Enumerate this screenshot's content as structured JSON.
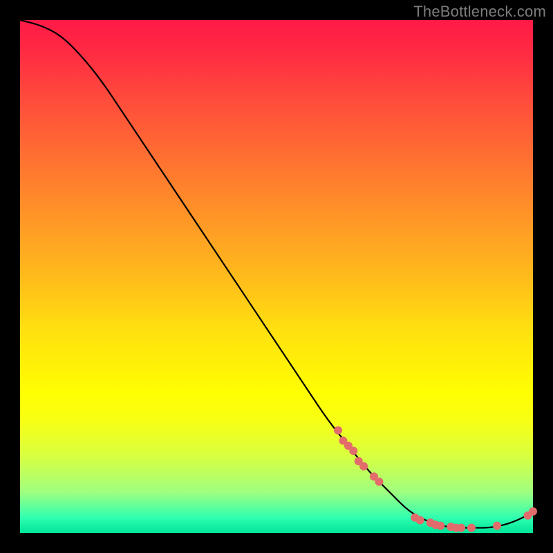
{
  "attribution": "TheBottleneck.com",
  "chart_data": {
    "type": "line",
    "title": "",
    "xlabel": "",
    "ylabel": "",
    "xlim": [
      0,
      100
    ],
    "ylim": [
      0,
      100
    ],
    "grid": false,
    "series": [
      {
        "name": "bottleneck-curve",
        "color": "#000000",
        "x": [
          0,
          4,
          8,
          12,
          16,
          20,
          24,
          28,
          32,
          36,
          40,
          44,
          48,
          52,
          56,
          60,
          64,
          68,
          72,
          76,
          80,
          84,
          88,
          92,
          96,
          100
        ],
        "y": [
          100,
          99,
          97,
          93,
          88,
          82,
          76,
          70,
          64,
          58,
          52,
          46,
          40,
          34,
          28,
          22,
          17,
          12,
          8,
          4,
          2,
          1,
          1,
          1,
          2,
          4
        ]
      }
    ],
    "markers": [
      {
        "name": "highlight-dots",
        "color": "#e26b6b",
        "radius": 6,
        "points": [
          {
            "x": 62,
            "y": 20
          },
          {
            "x": 63,
            "y": 18
          },
          {
            "x": 64,
            "y": 17
          },
          {
            "x": 65,
            "y": 16
          },
          {
            "x": 66,
            "y": 14
          },
          {
            "x": 67,
            "y": 13
          },
          {
            "x": 69,
            "y": 11
          },
          {
            "x": 70,
            "y": 10
          },
          {
            "x": 77,
            "y": 3
          },
          {
            "x": 78,
            "y": 2.5
          },
          {
            "x": 80,
            "y": 2
          },
          {
            "x": 81,
            "y": 1.6
          },
          {
            "x": 82,
            "y": 1.4
          },
          {
            "x": 84,
            "y": 1.2
          },
          {
            "x": 85,
            "y": 1.0
          },
          {
            "x": 86,
            "y": 1.0
          },
          {
            "x": 88,
            "y": 1.0
          },
          {
            "x": 93,
            "y": 1.4
          },
          {
            "x": 99,
            "y": 3.4
          },
          {
            "x": 100,
            "y": 4.2
          }
        ]
      }
    ]
  }
}
